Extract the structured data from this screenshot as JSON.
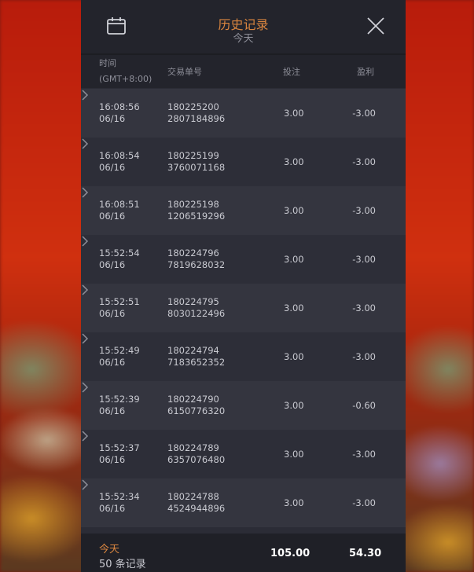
{
  "header": {
    "title": "历史记录",
    "subtitle": "今天",
    "calendar_icon": "calendar-icon",
    "close_icon": "close-icon"
  },
  "columns": {
    "time": "时间",
    "timezone": "(GMT+8:00)",
    "order": "交易单号",
    "bet": "投注",
    "profit": "盈利"
  },
  "rows": [
    {
      "time": "16:08:56",
      "date": "06/16",
      "id1": "180225200",
      "id2": "2807184896",
      "bet": "3.00",
      "profit": "-3.00"
    },
    {
      "time": "16:08:54",
      "date": "06/16",
      "id1": "180225199",
      "id2": "3760071168",
      "bet": "3.00",
      "profit": "-3.00"
    },
    {
      "time": "16:08:51",
      "date": "06/16",
      "id1": "180225198",
      "id2": "1206519296",
      "bet": "3.00",
      "profit": "-3.00"
    },
    {
      "time": "15:52:54",
      "date": "06/16",
      "id1": "180224796",
      "id2": "7819628032",
      "bet": "3.00",
      "profit": "-3.00"
    },
    {
      "time": "15:52:51",
      "date": "06/16",
      "id1": "180224795",
      "id2": "8030122496",
      "bet": "3.00",
      "profit": "-3.00"
    },
    {
      "time": "15:52:49",
      "date": "06/16",
      "id1": "180224794",
      "id2": "7183652352",
      "bet": "3.00",
      "profit": "-3.00"
    },
    {
      "time": "15:52:39",
      "date": "06/16",
      "id1": "180224790",
      "id2": "6150776320",
      "bet": "3.00",
      "profit": "-0.60"
    },
    {
      "time": "15:52:37",
      "date": "06/16",
      "id1": "180224789",
      "id2": "6357076480",
      "bet": "3.00",
      "profit": "-3.00"
    },
    {
      "time": "15:52:34",
      "date": "06/16",
      "id1": "180224788",
      "id2": "4524944896",
      "bet": "3.00",
      "profit": "-3.00"
    }
  ],
  "footer": {
    "label": "今天",
    "count": "50 条记录",
    "total_bet": "105.00",
    "total_profit": "54.30"
  },
  "colors": {
    "accent": "#d9853f",
    "panel": "#2b2c36"
  }
}
